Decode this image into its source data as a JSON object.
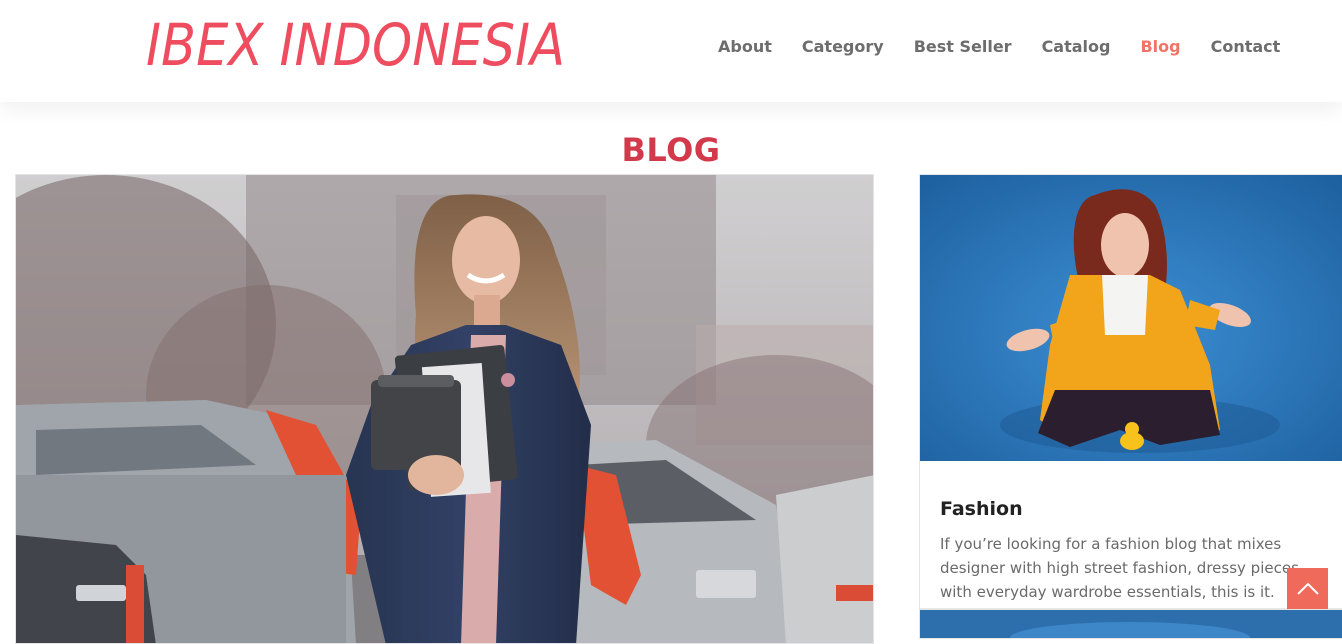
{
  "brand": {
    "logo_text": "IBEX INDONESIA",
    "accent_color": "#ee4d5f",
    "active_nav_color": "#f07566",
    "title_color": "#d23a4c"
  },
  "nav": {
    "items": [
      {
        "label": "About",
        "active": false
      },
      {
        "label": "Category",
        "active": false
      },
      {
        "label": "Best Seller",
        "active": false
      },
      {
        "label": "Catalog",
        "active": false
      },
      {
        "label": "Blog",
        "active": true
      },
      {
        "label": "Contact",
        "active": false
      }
    ]
  },
  "page": {
    "title": "BLOG"
  },
  "posts": {
    "featured": {
      "image_icon": "photo-woman-street"
    },
    "side": {
      "image_icon": "photo-woman-yellow-coat",
      "title": "Fashion",
      "excerpt": "If you’re looking for a fashion blog that mixes designer with high street fashion, dressy pieces with everyday wardrobe essentials, this is it."
    },
    "next": {
      "image_icon": "photo-blue"
    }
  },
  "back_to_top": {
    "icon": "chevron-up-icon",
    "color": "#f06a5c"
  }
}
